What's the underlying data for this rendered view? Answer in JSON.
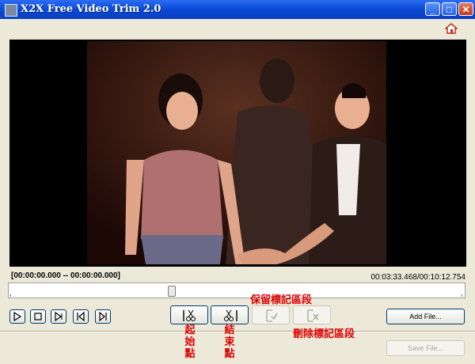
{
  "window": {
    "title": "X2X Free Video Trim 2.0"
  },
  "titlebar_buttons": {
    "minimize": "_",
    "maximize": "□",
    "close": "✕"
  },
  "timecodes": {
    "mark_range": "[00:00:00.000 -- 00:00:00.000]",
    "position": "00:03:33.468/00:10:12.754"
  },
  "seek": {
    "position_fraction": 0.349
  },
  "buttons": {
    "add_file": "Add File...",
    "save_file": "Save File..."
  },
  "annotations": {
    "keep_segment": "保留標記區段",
    "delete_segment": "刪除標記區段",
    "start_point": [
      "起",
      "始",
      "點"
    ],
    "end_point": [
      "結",
      "束",
      "點"
    ]
  },
  "icons": [
    "app-icon",
    "home-icon",
    "play-icon",
    "stop-icon",
    "step-forward-icon",
    "prev-frame-icon",
    "next-frame-icon",
    "set-start-scissors-icon",
    "set-end-scissors-icon",
    "keep-segment-icon",
    "delete-segment-icon"
  ],
  "colors": {
    "titlebar": "#0a4ad6",
    "annotation": "#e00000",
    "window_bg": "#ece9d8"
  }
}
